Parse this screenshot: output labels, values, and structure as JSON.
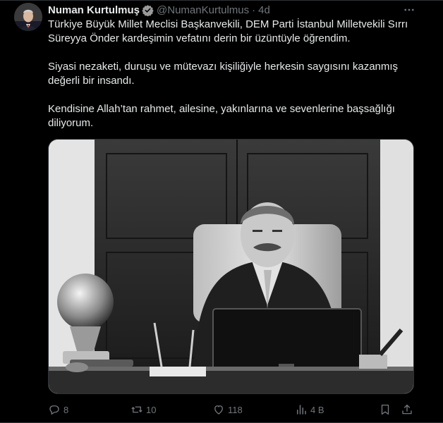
{
  "tweet": {
    "display_name": "Numan Kurtulmuş",
    "handle": "@NumanKurtulmus",
    "separator": "·",
    "time": "4d",
    "paragraphs": [
      "Türkiye Büyük Millet Meclisi Başkanvekili, DEM Parti İstanbul Milletvekili Sırrı Süreyya Önder kardeşimin vefatını derin bir üzüntüyle öğrendim.",
      "Siyasi nezaketi, duruşu ve mütevazı kişiliğiyle herkesin saygısını kazanmış değerli bir insandı.",
      "Kendisine Allah’tan rahmet, ailesine, yakınlarına ve sevenlerine başsağlığı diliyorum."
    ]
  },
  "actions": {
    "replies": "8",
    "reposts": "10",
    "likes": "118",
    "views": "4 B"
  },
  "icons": {
    "more": "more-icon",
    "verified": "verified-badge-icon",
    "reply": "reply-icon",
    "repost": "repost-icon",
    "like": "heart-icon",
    "views": "views-icon",
    "bookmark": "bookmark-icon",
    "share": "share-icon"
  },
  "colors": {
    "background": "#000000",
    "text": "#e7e9ea",
    "muted": "#71767b",
    "border": "#2f3336"
  }
}
